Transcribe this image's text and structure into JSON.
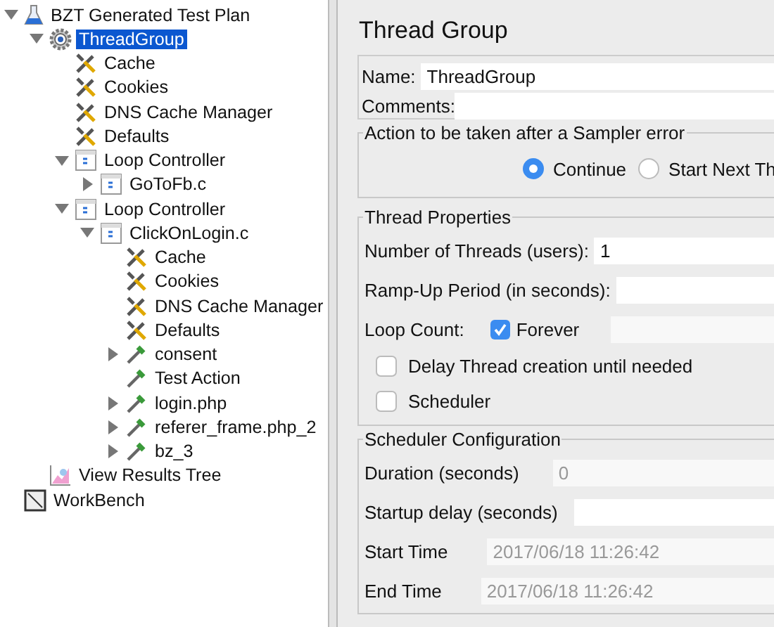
{
  "tree": [
    {
      "label": "BZT Generated Test Plan",
      "kind": "plan",
      "expanded": true,
      "selected": false,
      "children": [
        {
          "label": "ThreadGroup",
          "kind": "thread",
          "expanded": true,
          "selected": true,
          "children": [
            {
              "label": "Cache",
              "kind": "config",
              "selected": false
            },
            {
              "label": "Cookies",
              "kind": "config",
              "selected": false
            },
            {
              "label": "DNS Cache Manager",
              "kind": "config",
              "selected": false
            },
            {
              "label": "Defaults",
              "kind": "config",
              "selected": false
            },
            {
              "label": "Loop Controller",
              "kind": "controller",
              "expanded": true,
              "selected": false,
              "children": [
                {
                  "label": "GoToFb.c",
                  "kind": "controller",
                  "expanded": false,
                  "selected": false
                }
              ]
            },
            {
              "label": "Loop Controller",
              "kind": "controller",
              "expanded": true,
              "selected": false,
              "children": [
                {
                  "label": "ClickOnLogin.c",
                  "kind": "controller",
                  "expanded": true,
                  "selected": false,
                  "children": [
                    {
                      "label": "Cache",
                      "kind": "config",
                      "selected": false
                    },
                    {
                      "label": "Cookies",
                      "kind": "config",
                      "selected": false
                    },
                    {
                      "label": "DNS Cache Manager",
                      "kind": "config",
                      "selected": false
                    },
                    {
                      "label": "Defaults",
                      "kind": "config",
                      "selected": false
                    },
                    {
                      "label": "consent",
                      "kind": "sampler",
                      "expanded": false,
                      "selected": false
                    },
                    {
                      "label": "Test Action",
                      "kind": "sampler",
                      "selected": false
                    },
                    {
                      "label": "login.php",
                      "kind": "sampler",
                      "expanded": false,
                      "selected": false
                    },
                    {
                      "label": "referer_frame.php_2",
                      "kind": "sampler",
                      "expanded": false,
                      "selected": false
                    },
                    {
                      "label": "bz_3",
                      "kind": "sampler",
                      "expanded": false,
                      "selected": false
                    }
                  ]
                }
              ]
            }
          ]
        },
        {
          "label": "View Results Tree",
          "kind": "listener",
          "selected": false
        }
      ]
    },
    {
      "label": "WorkBench",
      "kind": "workbench",
      "selected": false
    }
  ],
  "editor": {
    "title": "Thread Group",
    "name": {
      "label": "Name:",
      "value": "ThreadGroup"
    },
    "comments": {
      "label": "Comments:"
    },
    "error_action": {
      "legend": "Action to be taken after a Sampler error",
      "options": [
        {
          "label": "Continue",
          "selected": true
        },
        {
          "label": "Start Next Th",
          "selected": false
        }
      ]
    },
    "thread_properties": {
      "legend": "Thread Properties",
      "threads": {
        "label": "Number of Threads (users):",
        "value": "1"
      },
      "ramp_up": {
        "label": "Ramp-Up Period (in seconds):"
      },
      "loop_count": {
        "label": "Loop Count:",
        "forever_label": "Forever",
        "forever_checked": true
      },
      "options": [
        {
          "label": "Delay Thread creation until needed",
          "checked": false
        },
        {
          "label": "Scheduler",
          "checked": false
        }
      ]
    },
    "scheduler": {
      "legend": "Scheduler Configuration",
      "fields": [
        {
          "label": "Duration (seconds)",
          "value": "0",
          "disabled": true
        },
        {
          "label": "Startup delay (seconds)"
        },
        {
          "label": "Start Time",
          "value": "2017/06/18 11:26:42",
          "disabled": true
        },
        {
          "label": "End Time",
          "value": "2017/06/18 11:26:42",
          "disabled": true
        }
      ]
    }
  }
}
